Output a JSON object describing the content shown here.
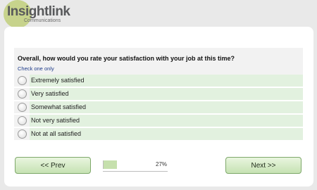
{
  "brand": {
    "name": "Insightlink",
    "sub": "Communications"
  },
  "question": {
    "text": "Overall, how would you rate your satisfaction with your job at this time?",
    "instruction": "Check one only"
  },
  "options": [
    {
      "label": "Extremely satisfied"
    },
    {
      "label": "Very satisfied"
    },
    {
      "label": "Somewhat satisfied"
    },
    {
      "label": "Not very satisfied"
    },
    {
      "label": "Not at all satisfied"
    }
  ],
  "nav": {
    "prev_label": "<< Prev",
    "next_label": "Next >>"
  },
  "progress": {
    "label": "27%",
    "fraction": 0.27
  },
  "colors": {
    "accent": "#c6e0ad",
    "option_bg": "#e2f1df"
  }
}
